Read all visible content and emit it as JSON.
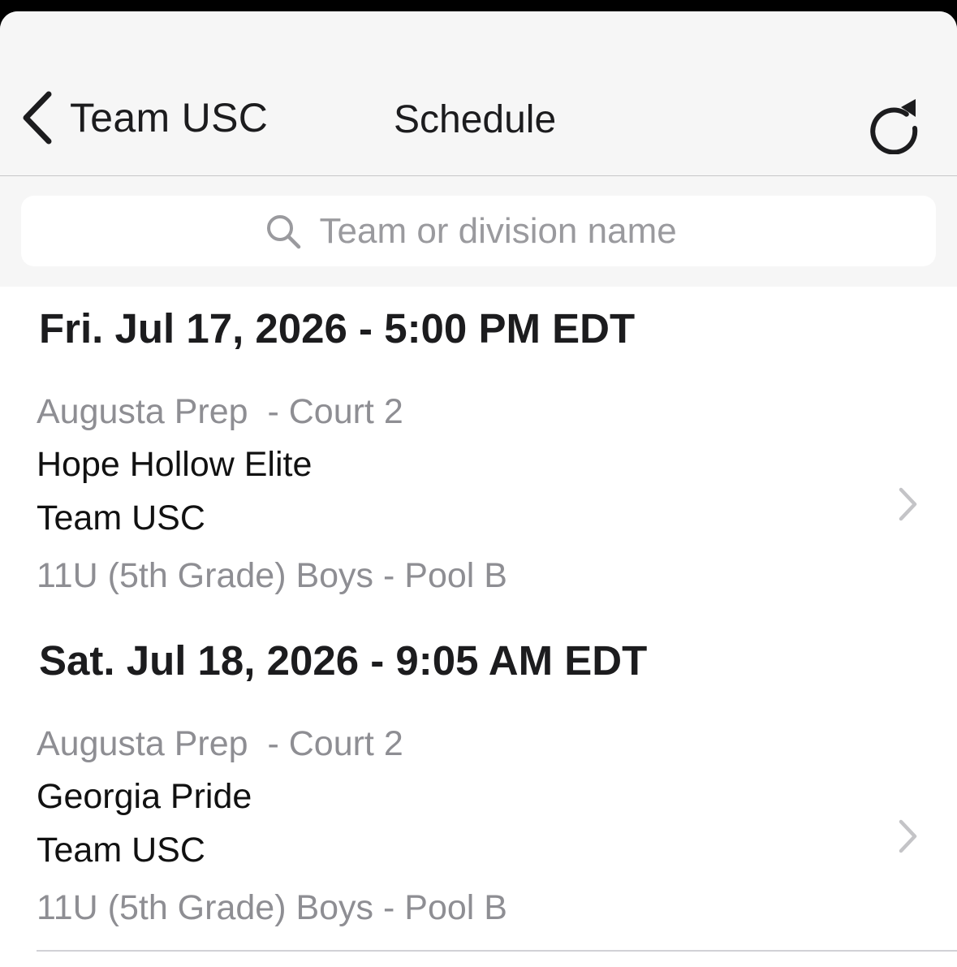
{
  "nav": {
    "back_label": "Team USC",
    "title": "Schedule",
    "back_icon": "chevron-left-icon",
    "refresh_icon": "refresh-icon"
  },
  "search": {
    "placeholder": "Team or division name",
    "value": "",
    "icon": "magnifier-icon"
  },
  "games": [
    {
      "date_header": "Fri. Jul 17, 2026 - 5:00 PM EDT",
      "location": "Augusta Prep  - Court 2",
      "team_1": "Hope Hollow Elite",
      "team_2": "Team USC",
      "division": "11U (5th Grade) Boys - Pool B"
    },
    {
      "date_header": "Sat. Jul 18, 2026 - 9:05 AM EDT",
      "location": "Augusta Prep  - Court 2",
      "team_1": "Georgia Pride",
      "team_2": "Team USC",
      "division": "11U (5th Grade) Boys - Pool B"
    }
  ],
  "colors": {
    "nav_background": "#f6f6f6",
    "primary_text": "#1c1c1e",
    "secondary_text": "#8e8e93",
    "chevron": "#c4c4c7"
  }
}
